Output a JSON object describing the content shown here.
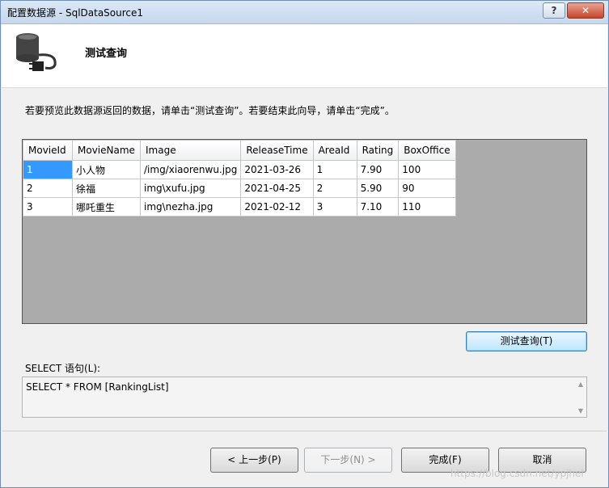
{
  "window": {
    "title": "配置数据源 - SqlDataSource1",
    "help_label": "?",
    "close_label": "✕"
  },
  "header": {
    "title": "测试查询",
    "icon": "database-plug-icon"
  },
  "instruction": "若要预览此数据源返回的数据，请单击“测试查询”。若要结束此向导，请单击“完成”。",
  "grid": {
    "columns": [
      "MovieId",
      "MovieName",
      "Image",
      "ReleaseTime",
      "AreaId",
      "Rating",
      "BoxOffice"
    ],
    "rows": [
      [
        "1",
        "小人物",
        "/img/xiaorenwu.jpg",
        "2021-03-26",
        "1",
        "7.90",
        "100"
      ],
      [
        "2",
        "徐福",
        "img\\xufu.jpg",
        "2021-04-25",
        "2",
        "5.90",
        "90"
      ],
      [
        "3",
        "哪吒重生",
        "img\\nezha.jpg",
        "2021-02-12",
        "3",
        "7.10",
        "110"
      ]
    ]
  },
  "test_button": "测试查询(T)",
  "sql": {
    "label": "SELECT 语句(L):",
    "statement": "SELECT * FROM [RankingList]"
  },
  "footer": {
    "prev": "< 上一步(P)",
    "next": "下一步(N) >",
    "finish": "完成(F)",
    "cancel": "取消"
  },
  "watermark": "https://blog.csdn.net/ypjhel",
  "colors": {
    "selected_cell": "#3399ff",
    "grid_background": "#ababab"
  }
}
